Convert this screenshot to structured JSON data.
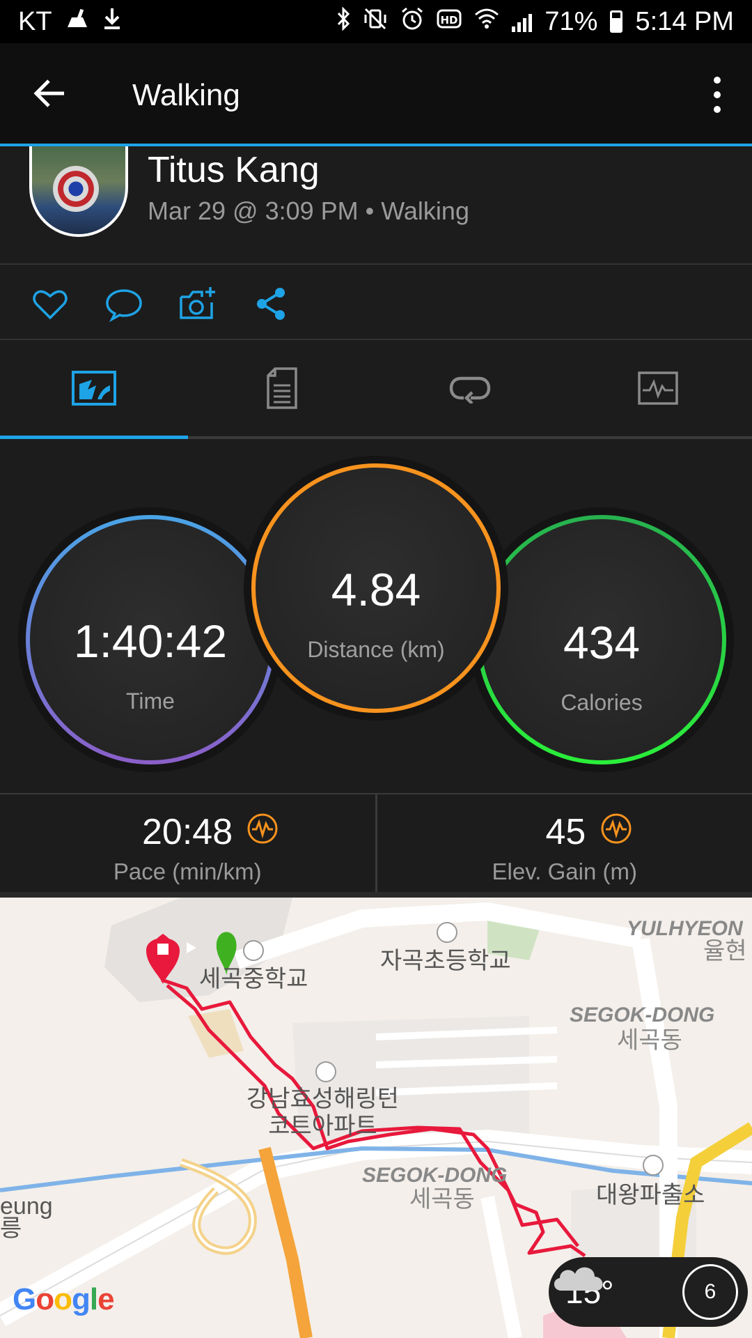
{
  "status_bar": {
    "carrier": "KT",
    "battery": "71%",
    "time": "5:14 PM",
    "battery_level": 0.71,
    "icons": [
      "cleaner-icon",
      "download-icon",
      "bluetooth-icon",
      "vibrate-icon",
      "alarm-icon",
      "hd-icon",
      "wifi-icon",
      "signal-icon",
      "battery-icon"
    ]
  },
  "toolbar": {
    "title": "Walking",
    "icons": [
      "back-arrow-icon",
      "overflow-menu-icon"
    ]
  },
  "activity": {
    "user_name": "Titus Kang",
    "meta": "Mar 29 @ 3:09 PM • Walking"
  },
  "actions": [
    "like-icon",
    "comment-icon",
    "add-photo-icon",
    "share-icon"
  ],
  "tabs": [
    {
      "icon": "overview-icon",
      "active": true
    },
    {
      "icon": "details-icon",
      "active": false
    },
    {
      "icon": "laps-icon",
      "active": false
    },
    {
      "icon": "charts-icon",
      "active": false
    }
  ],
  "stats": {
    "time": {
      "value": "1:40:42",
      "label": "Time",
      "color": "#4a90d9"
    },
    "distance": {
      "value": "4.84",
      "label": "Distance (km)",
      "color": "#f7931e"
    },
    "calories": {
      "value": "434",
      "label": "Calories",
      "color": "#29d34a"
    }
  },
  "substats": {
    "pace": {
      "value": "20:48",
      "label": "Pace (min/km)"
    },
    "elev": {
      "value": "45",
      "label": "Elev. Gain (m)"
    }
  },
  "map": {
    "labels": {
      "school1": "세곡중학교",
      "school2": "자곡초등학교",
      "apt": "강남효성해링턴\n코트아파트",
      "dong1_en": "SEGOK-DONG",
      "dong1_kr": "세곡동",
      "dong2_en": "SEGOK-DONG",
      "dong2_kr": "세곡동",
      "yulhyeon_en": "YULHYEON",
      "yulhyeon_kr": "율현",
      "police": "대왕파출소",
      "eung": "eung",
      "reung_kr": "릉"
    },
    "route_color": "#e8193c",
    "google": "Google"
  },
  "weather": {
    "temp": "15°",
    "uv": "6",
    "icon": "cloud-icon"
  }
}
